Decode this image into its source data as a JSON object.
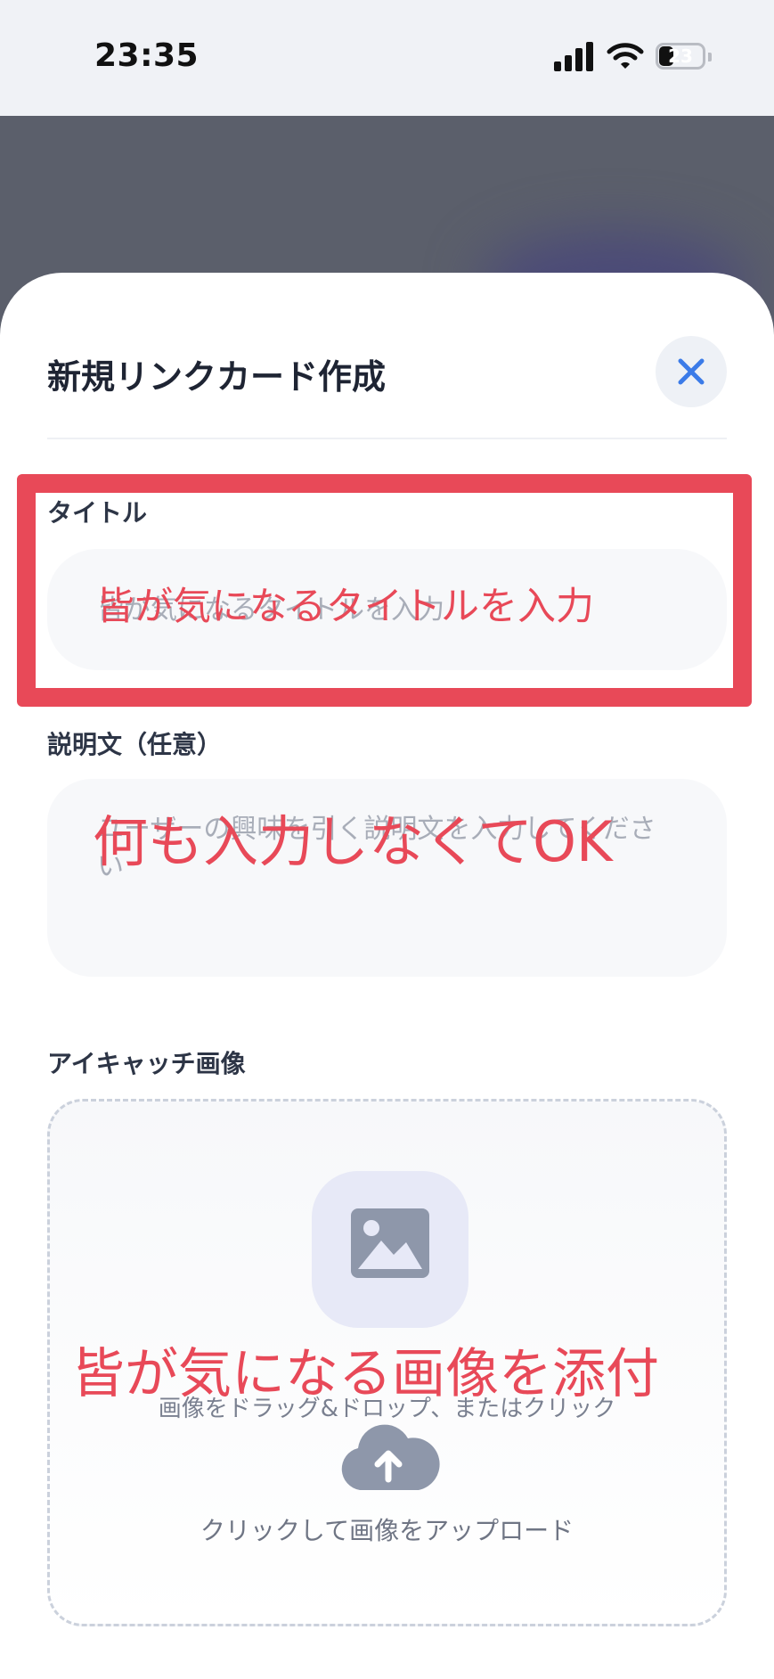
{
  "status_bar": {
    "time": "23:35",
    "battery_level": "23"
  },
  "sheet": {
    "title": "新規リンクカード作成"
  },
  "fields": {
    "title_label": "タイトル",
    "title_placeholder": "皆が気になるタイトルを入力",
    "description_label": "説明文（任意）",
    "description_placeholder": "ユーザーの興味を引く説明文を入力してください",
    "image_label": "アイキャッチ画像"
  },
  "upload": {
    "drag_drop_text": "画像をドラッグ&ドロップ、またはクリック",
    "click_upload_text": "クリックして画像をアップロード"
  },
  "annotations": {
    "title_note": "皆が気になるタイトルを入力",
    "description_note": "何も入力しなくてOK",
    "image_note": "皆が気になる画像を添付"
  },
  "colors": {
    "annotation_red": "#e84958",
    "close_blue": "#3b7be8",
    "icon_gray": "#8e97aa"
  }
}
